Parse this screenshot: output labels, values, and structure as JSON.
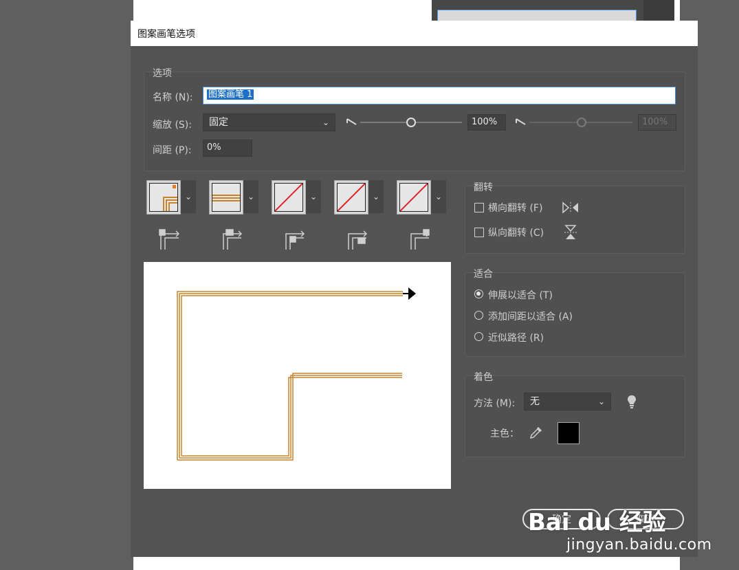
{
  "dialog": {
    "title": "图案画笔选项",
    "options_group": "选项",
    "name_label": "名称 (N):",
    "name_value": "图案画笔 1",
    "scale_label": "缩放 (S):",
    "scale_value": "固定",
    "scale_pct": "100%",
    "scale_pct2": "100%",
    "spacing_label": "间距 (P):",
    "spacing_value": "0%",
    "flip_group": "翻转",
    "flip_h": "横向翻转 (F)",
    "flip_v": "纵向翻转 (C)",
    "fit_group": "适合",
    "fit_options": [
      "伸展以适合 (T)",
      "添加间距以适合 (A)",
      "近似路径 (R)"
    ],
    "fit_selected": 0,
    "colorize_group": "着色",
    "method_label": "方法 (M):",
    "method_value": "无",
    "key_color_label": "主色：",
    "key_color": "#000000",
    "ok_label": "确定",
    "cancel_label": "取消"
  },
  "watermark": {
    "logo": "Bai du 经验",
    "url": "jingyan.baidu.com"
  },
  "colors": {
    "dialog_bg": "#535353",
    "pattern": "#c8842b",
    "accent": "#1e6fc8"
  }
}
